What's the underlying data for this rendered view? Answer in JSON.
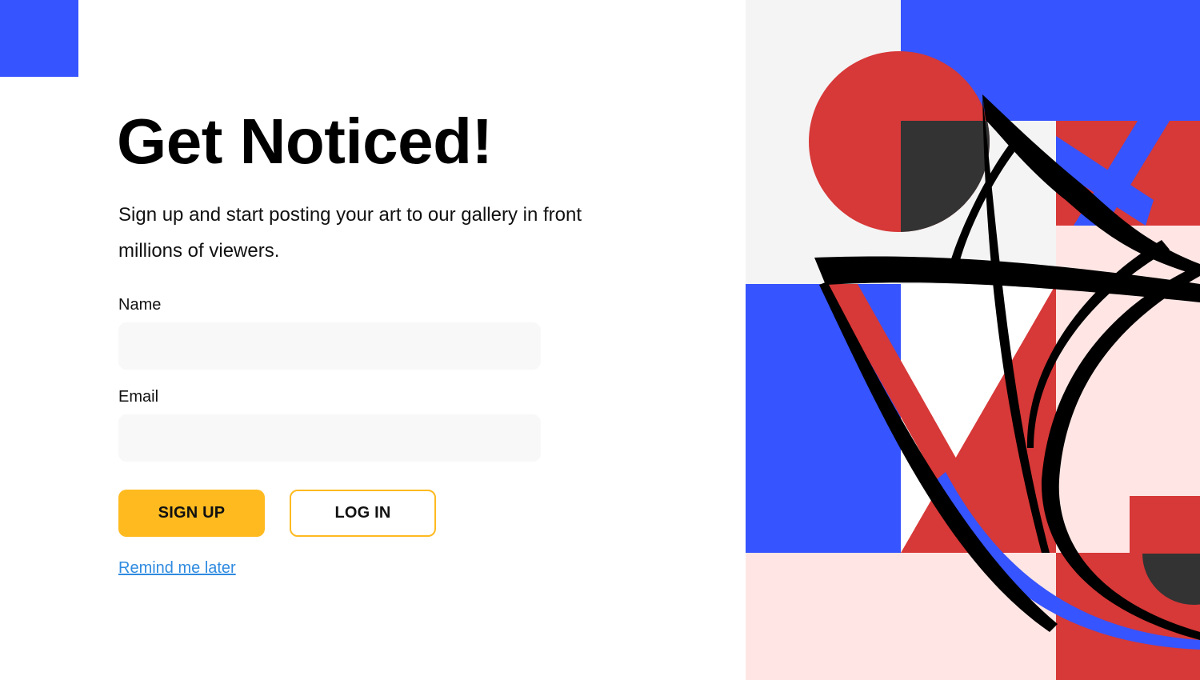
{
  "hero": {
    "title": "Get Noticed!",
    "subtitle": "Sign up and start posting your art to our gallery in front millions of viewers."
  },
  "form": {
    "name_label": "Name",
    "name_value": "",
    "email_label": "Email",
    "email_value": ""
  },
  "actions": {
    "signup_label": "SIGN UP",
    "login_label": "LOG IN",
    "remind_label": "Remind me later"
  },
  "colors": {
    "blue": "#3654FF",
    "red": "#D73838",
    "pink": "#FFE6E4",
    "dark": "#333333",
    "yellow": "#FFBA20",
    "link": "#2F8BE0"
  }
}
